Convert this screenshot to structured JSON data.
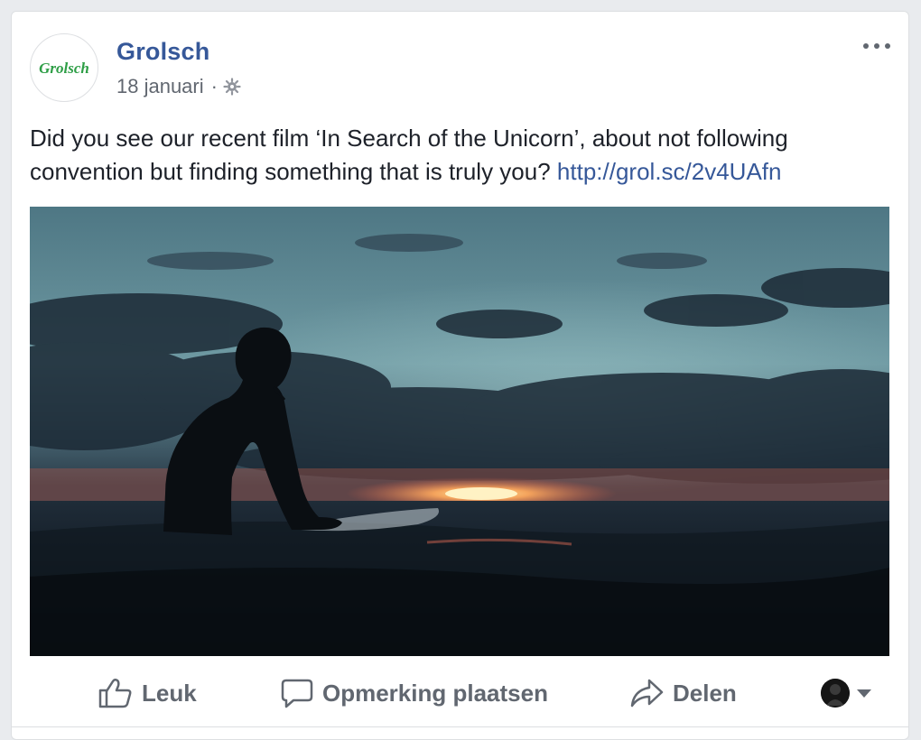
{
  "post": {
    "page_name": "Grolsch",
    "avatar_logo_text": "Grolsch",
    "date": "18 januari",
    "separator": "·",
    "privacy_icon": "globe-icon",
    "more_icon": "more-options-icon",
    "text_main": "Did you see our recent film ‘In Search of the Unicorn’, about not following convention but finding something that is truly you? ",
    "link_text": "http://grol.sc/2v4UAfn",
    "photo_alt": "Silhouette of a surfer sitting on a surfboard in the sea at sunset under a cloudy sky"
  },
  "actions": {
    "like_label": "Leuk",
    "comment_label": "Opmerking plaatsen",
    "share_label": "Delen"
  },
  "colors": {
    "link": "#365899",
    "text": "#1d2129",
    "secondary": "#616770",
    "logo_green": "#2e9e46"
  }
}
